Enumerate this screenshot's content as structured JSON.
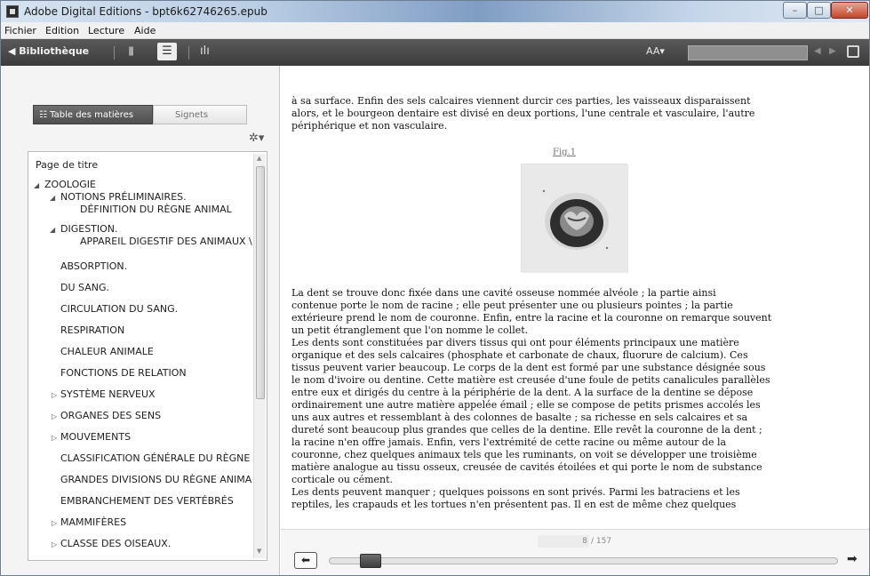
{
  "window": {
    "title": "Adobe Digital Editions - bpt6k62746265.epub",
    "controls": {
      "minimize": "–",
      "maximize": "□",
      "close": "✕"
    }
  },
  "menu": [
    "Fichier",
    "Edition",
    "Lecture",
    "Aide"
  ],
  "toolbar": {
    "library_label": "◀ Bibliothèque",
    "font_size_label": "AA▾"
  },
  "sidebar": {
    "tabs": {
      "toc": "Table des matières",
      "bookmarks": "Signets"
    },
    "toc": [
      {
        "label": "Page de titre",
        "level": 0,
        "expander": ""
      },
      {
        "label": "ZOOLOGIE",
        "level": 0,
        "expander": "expanded"
      },
      {
        "label": "NOTIONS PRÉLIMINAIRES.",
        "label2": "DÉFINITION DU RÈGNE ANIMAL",
        "level": 1,
        "expander": "expanded"
      },
      {
        "label": "DIGESTION.",
        "label2": "APPAREIL DIGESTIF DES ANIMAUX \\",
        "level": 1,
        "expander": "expanded"
      },
      {
        "label": "ABSORPTION.",
        "level": 1,
        "expander": ""
      },
      {
        "label": "DU SANG.",
        "level": 1,
        "expander": ""
      },
      {
        "label": "CIRCULATION DU SANG.",
        "level": 1,
        "expander": ""
      },
      {
        "label": "RESPIRATION",
        "level": 1,
        "expander": ""
      },
      {
        "label": "CHALEUR ANIMALE",
        "level": 1,
        "expander": ""
      },
      {
        "label": "FONCTIONS DE RELATION",
        "level": 1,
        "expander": ""
      },
      {
        "label": "SYSTÈME NERVEUX",
        "level": 1,
        "expander": "collapsed"
      },
      {
        "label": "ORGANES DES SENS",
        "level": 1,
        "expander": "collapsed"
      },
      {
        "label": "MOUVEMENTS",
        "level": 1,
        "expander": "collapsed"
      },
      {
        "label": "CLASSIFICATION GÉNÉRALE DU RÈGNE",
        "level": 1,
        "expander": ""
      },
      {
        "label": "GRANDES DIVISIONS DU RÈGNE ANIMA",
        "level": 1,
        "expander": ""
      },
      {
        "label": "EMBRANCHEMENT DES VERTÉBRÉS",
        "level": 1,
        "expander": ""
      },
      {
        "label": "MAMMIFÈRES",
        "level": 1,
        "expander": "collapsed"
      },
      {
        "label": "CLASSE DES OISEAUX.",
        "level": 1,
        "expander": "collapsed"
      }
    ]
  },
  "reader": {
    "lines": [
      "à sa surface. Enfin des sels calcaires viennent durcir ces parties, les vaisseaux disparaissent",
      "alors, et le bourgeon dentaire est divisé en deux portions, l'une centrale et vasculaire, l'autre",
      "périphérique et non vasculaire.",
      "   La dent se trouve donc fixée dans une cavité osseuse nommée alvéole ; la partie ainsi",
      "contenue porte le nom de racine ; elle peut présenter une ou plusieurs pointes ; la partie",
      "extérieure prend le nom de couronne. Enfin, entre la racine et la couronne on remarque souvent",
      "un petit étranglement que l'on nomme le collet.",
      "   Les dents sont constituées par divers tissus qui ont pour éléments principaux une matière",
      "organique et des sels calcaires (phosphate et carbonate de chaux, fluorure de calcium). Ces",
      "tissus peuvent varier beaucoup. Le corps de la dent est formé par une substance désignée sous",
      "le nom d'ivoire ou dentine. Cette matière est creusée d'une foule de petits canalicules parallèles",
      "entre eux et dirigés du centre à la périphérie de la dent. A la surface de la dentine se dépose",
      "ordinairement une autre matière appelée émail ; elle se compose de petits prismes accolés les",
      "uns aux autres et ressemblant à des colonnes de basalte ; sa richesse en sels calcaires et sa",
      "dureté sont beaucoup plus grandes que celles de la dentine. Elle revêt la couronne de la dent ;",
      "la racine n'en offre jamais. Enfin, vers l'extrémité de cette racine ou même autour de la",
      "couronne, chez quelques animaux tels que les ruminants, on voit se développer une troisième",
      "matière analogue au tissu osseux, creusée de cavités étoilées et qui porte le nom de substance",
      "corticale ou cément.",
      "   Les dents peuvent manquer ; quelques poissons en sont privés. Parmi les batraciens et les",
      "reptiles, les crapauds et les tortues n'en présentent pas. Il en est de même chez quelques"
    ],
    "figure_label": "Fig.1"
  },
  "pager": {
    "current_page": "8",
    "total": "/ 157",
    "progress": 0.05
  }
}
